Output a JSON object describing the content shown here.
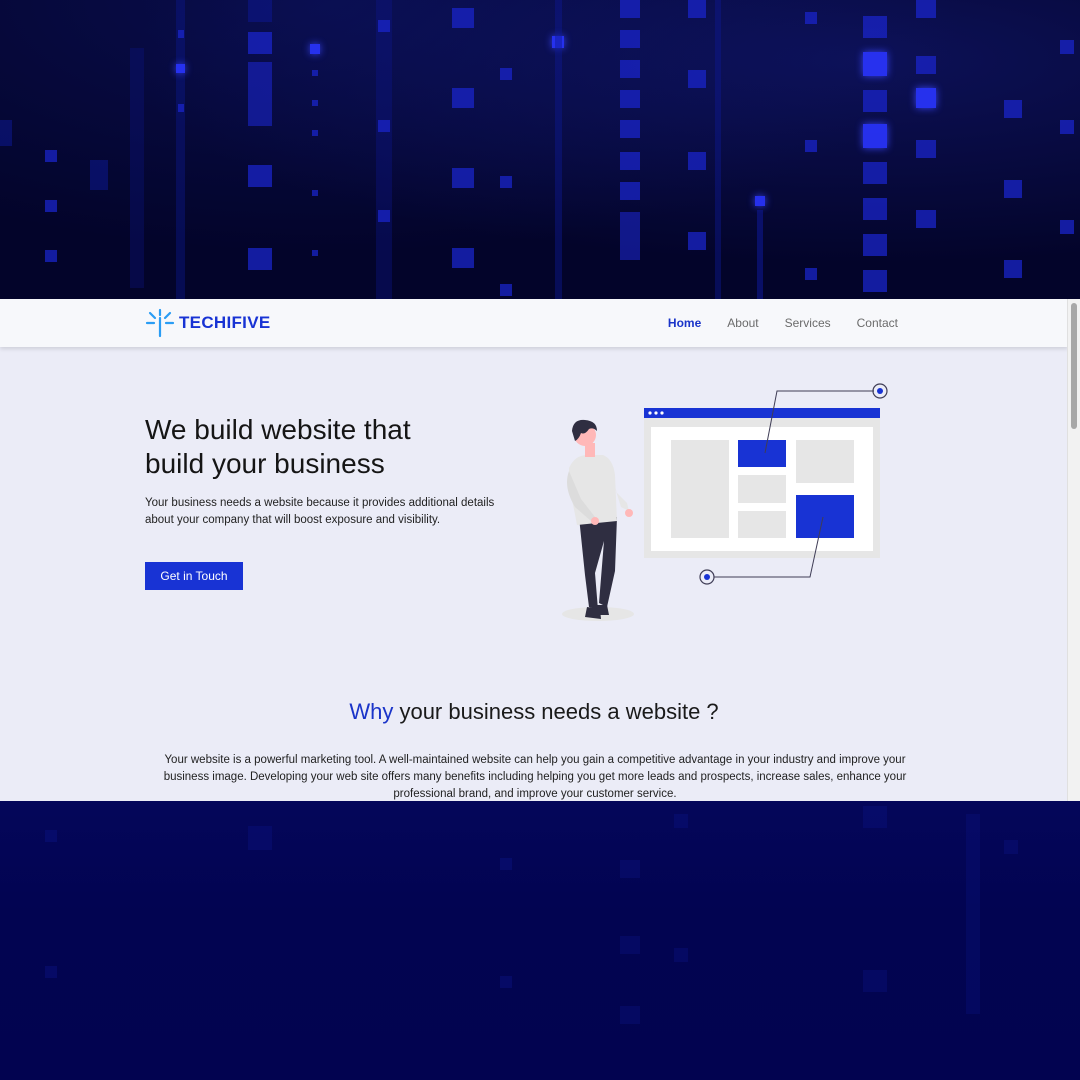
{
  "brand": {
    "name": "TECHIFIVE",
    "icon": "spark-logo-icon",
    "color": "#1833d4"
  },
  "nav": {
    "items": [
      {
        "label": "Home",
        "active": true
      },
      {
        "label": "About",
        "active": false
      },
      {
        "label": "Services",
        "active": false
      },
      {
        "label": "Contact",
        "active": false
      }
    ]
  },
  "hero": {
    "title_line1": "We build website that",
    "title_line2": "build your business",
    "text": "Your business needs a website because it provides additional details about your company that will boost exposure and visibility.",
    "cta_label": "Get in Touch",
    "illustration": "person-with-website-wireframe-illustration"
  },
  "why": {
    "title_accent": "Why",
    "title_rest": " your business needs a website ?",
    "text": "Your website is a powerful marketing tool. A well-maintained website can help you gain a competitive advantage in your industry and improve your business image. Developing your web site offers many benefits including helping you get more leads and prospects, increase sales, enhance your professional brand, and improve your customer service."
  },
  "colors": {
    "accent": "#1833d4",
    "page_background": "#ebecf7",
    "outer_background": "#03042a"
  }
}
